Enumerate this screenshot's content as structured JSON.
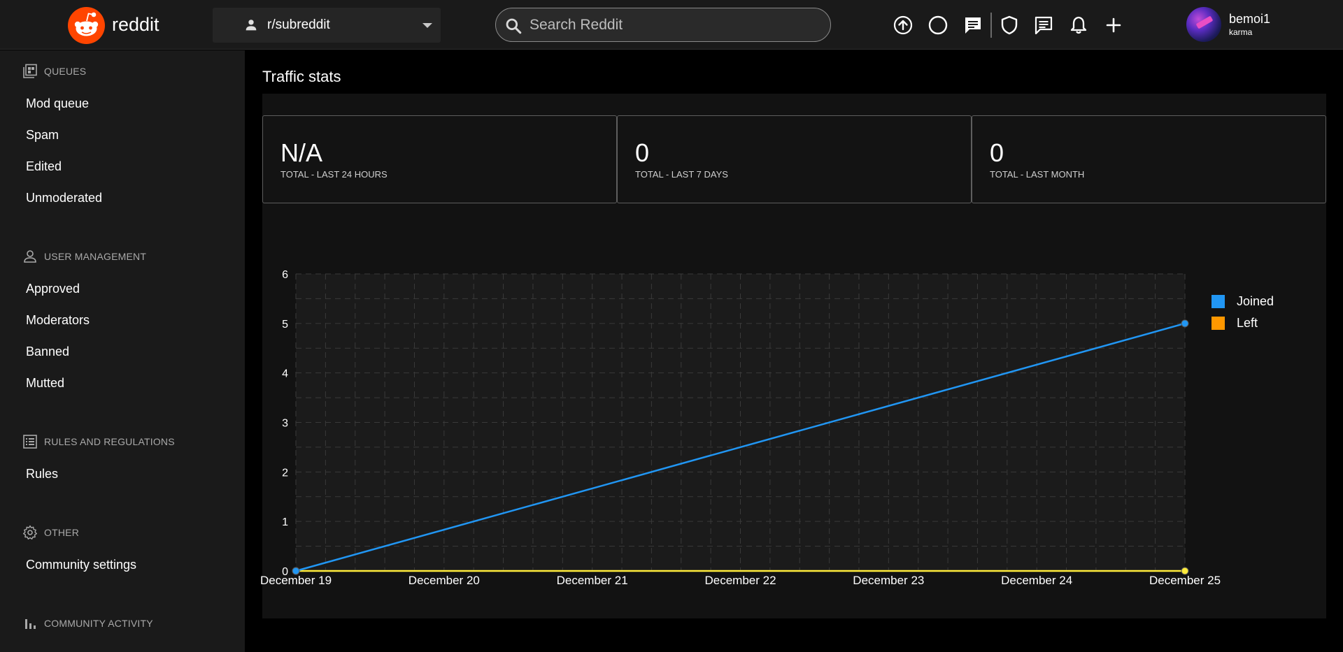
{
  "header": {
    "brand": "reddit",
    "subreddit": "r/subreddit",
    "search_placeholder": "Search Reddit",
    "user": {
      "name": "bemoi1",
      "karma": "karma"
    }
  },
  "sidebar": {
    "sections": [
      {
        "title": "QUEUES",
        "icon": "queue-icon",
        "items": [
          "Mod queue",
          "Spam",
          "Edited",
          "Unmoderated"
        ]
      },
      {
        "title": "USER MANAGEMENT",
        "icon": "person-icon",
        "items": [
          "Approved",
          "Moderators",
          "Banned",
          "Mutted"
        ]
      },
      {
        "title": "RULES AND REGULATIONS",
        "icon": "list-icon",
        "items": [
          "Rules"
        ]
      },
      {
        "title": "OTHER",
        "icon": "gear-icon",
        "items": [
          "Community settings"
        ]
      },
      {
        "title": "COMMUNITY ACTIVITY",
        "icon": "bar-chart-icon",
        "items": []
      }
    ]
  },
  "main": {
    "title": "Traffic stats",
    "stats": [
      {
        "value": "N/A",
        "label": "TOTAL - LAST 24 HOURS"
      },
      {
        "value": "0",
        "label": "TOTAL - LAST 7 DAYS"
      },
      {
        "value": "0",
        "label": "TOTAL - LAST MONTH"
      }
    ]
  },
  "colors": {
    "joined": "#2196f3",
    "left": "#ff9800",
    "left_line": "#ffeb3b",
    "brand": "#ff4500"
  },
  "chart_data": {
    "type": "line",
    "categories": [
      "December 19",
      "December 20",
      "December 21",
      "December 22",
      "December 23",
      "December 24",
      "December 25"
    ],
    "series": [
      {
        "name": "Joined",
        "x": [
          "December 19",
          "December 25"
        ],
        "values": [
          0,
          5
        ]
      },
      {
        "name": "Left",
        "x": [
          "December 19",
          "December 25"
        ],
        "values": [
          0,
          0
        ]
      }
    ],
    "yticks": [
      "0",
      "1",
      "2",
      "3",
      "4",
      "5",
      "6"
    ],
    "ylim": [
      0,
      6
    ],
    "grid": true,
    "legend": "right",
    "title": "",
    "xlabel": "",
    "ylabel": ""
  }
}
